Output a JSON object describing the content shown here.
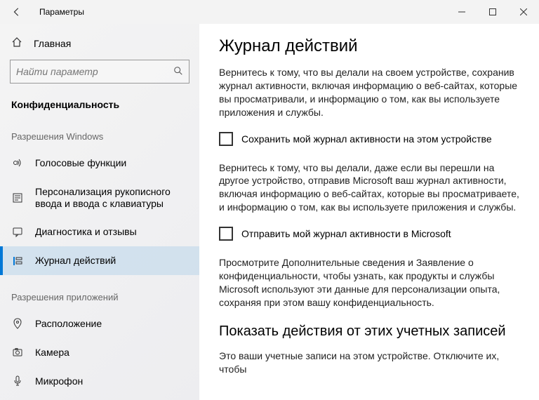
{
  "window": {
    "title": "Параметры"
  },
  "sidebar": {
    "home_label": "Главная",
    "search_placeholder": "Найти параметр",
    "section_current": "Конфиденциальность",
    "group1_title": "Разрешения Windows",
    "group1_items": [
      {
        "label": "Голосовые функции"
      },
      {
        "label": "Персонализация рукописного ввода и ввода с клавиатуры"
      },
      {
        "label": "Диагностика и отзывы"
      },
      {
        "label": "Журнал действий"
      }
    ],
    "group2_title": "Разрешения приложений",
    "group2_items": [
      {
        "label": "Расположение"
      },
      {
        "label": "Камера"
      },
      {
        "label": "Микрофон"
      }
    ]
  },
  "content": {
    "heading": "Журнал действий",
    "para1": "Вернитесь к тому, что вы делали на своем устройстве, сохранив журнал активности, включая информацию о веб-сайтах, которые вы просматривали, и информацию о том, как вы используете приложения и службы.",
    "check1_label": "Сохранить мой журнал активности на этом устройстве",
    "para2": "Вернитесь к тому, что вы делали, даже если вы перешли на другое устройство, отправив Microsoft ваш журнал активности, включая информацию о веб-сайтах, которые вы просматриваете, и информацию о том, как вы используете приложения и службы.",
    "check2_label": "Отправить мой журнал активности в Microsoft",
    "para3": "Просмотрите Дополнительные сведения и Заявление о конфиденциальности, чтобы узнать, как продукты и службы Microsoft используют эти данные для персонализации опыта, сохраняя при этом вашу конфиденциальность.",
    "heading2": "Показать действия от этих учетных записей",
    "para4": "Это ваши учетные записи на этом устройстве. Отключите их, чтобы"
  }
}
